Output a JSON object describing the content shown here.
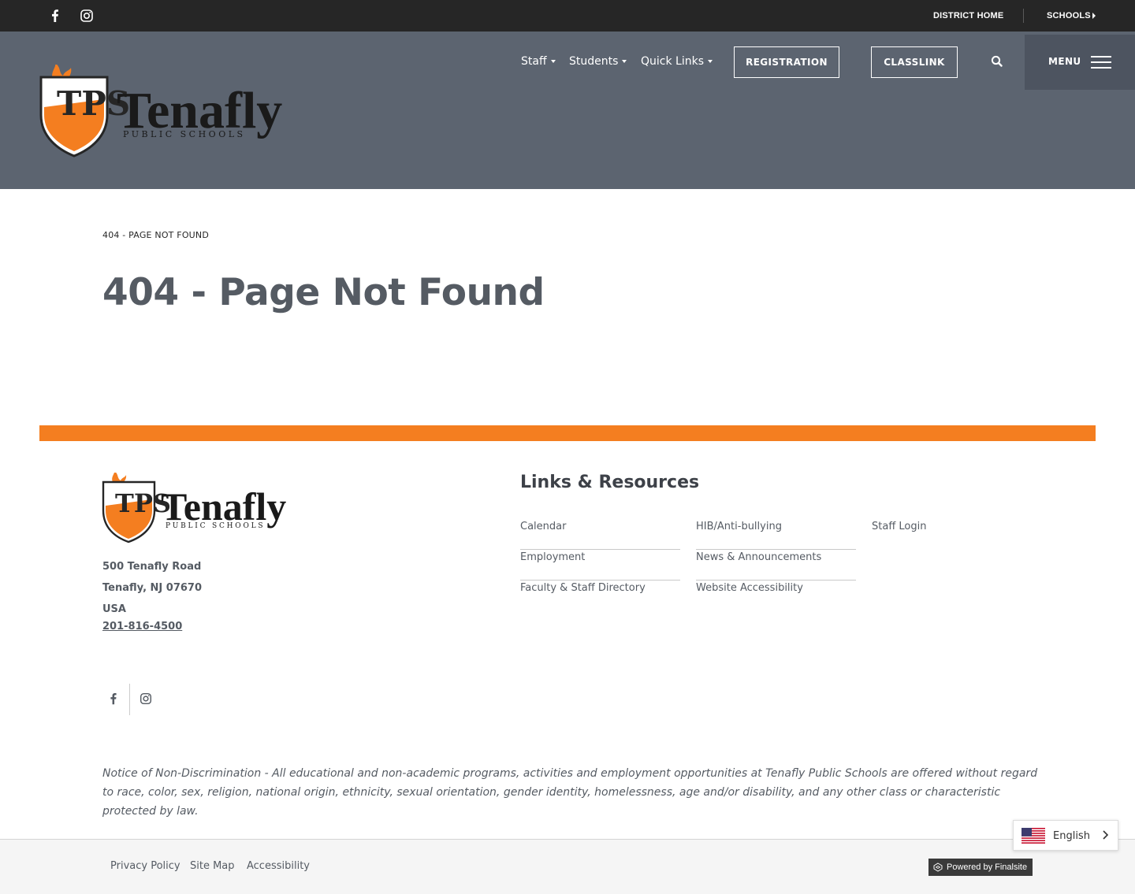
{
  "topbar": {
    "social": [
      {
        "icon": "facebook-icon"
      },
      {
        "icon": "instagram-icon"
      }
    ],
    "district_home": "DISTRICT HOME",
    "schools": "SCHOOLS"
  },
  "header": {
    "logo": {
      "monogram": "TPS",
      "name": "Tenafly",
      "tagline": "PUBLIC SCHOOLS"
    },
    "nav": [
      {
        "label": "Staff"
      },
      {
        "label": "Students"
      },
      {
        "label": "Quick Links"
      }
    ],
    "registration": "REGISTRATION",
    "classlink": "CLASSLINK",
    "menu": "MENU"
  },
  "main": {
    "breadcrumb": "404 - PAGE NOT FOUND",
    "title": "404 - Page Not Found"
  },
  "footer": {
    "address": {
      "street": "500 Tenafly Road",
      "city": "Tenafly, NJ  07670",
      "country": "USA",
      "phone": "201-816-4500"
    },
    "links_title": "Links & Resources",
    "links": [
      {
        "label": "Calendar"
      },
      {
        "label": "HIB/Anti-bullying"
      },
      {
        "label": "Staff Login"
      },
      {
        "label": "Employment"
      },
      {
        "label": "News & Announcements"
      },
      {
        "label": "Faculty & Staff Directory"
      },
      {
        "label": "Website Accessibility"
      }
    ],
    "notice": "Notice of Non-Discrimination - All educational and non-academic programs, activities and employment opportunities at Tenafly Public Schools are offered without regard to race, color, sex, religion, national origin, ethnicity, sexual orientation, gender identity, homelessness, age and/or disability, and any other class or characteristic protected by law.",
    "bottom_links": [
      {
        "label": "Privacy Policy"
      },
      {
        "label": "Site Map"
      },
      {
        "label": "Accessibility"
      }
    ],
    "powered_by": "Powered by Finalsite"
  },
  "language": {
    "selected": "English"
  },
  "colors": {
    "topbar": "#262626",
    "header": "#5c6470",
    "accent_orange": "#f47e20",
    "title_gray": "#555b63"
  }
}
